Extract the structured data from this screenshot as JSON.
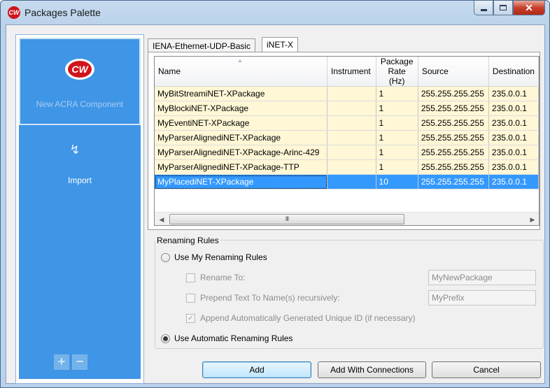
{
  "window": {
    "title": "Packages Palette",
    "app_icon": "CW"
  },
  "left_panel": {
    "new_component_label": "New ACRA Component",
    "logo_text": "CW",
    "import_label": "Import",
    "add_glyph": "+",
    "remove_glyph": "−"
  },
  "tabs": [
    {
      "label": "IENA-Ethernet-UDP-Basic",
      "active": false
    },
    {
      "label": "iNET-X",
      "active": true
    }
  ],
  "grid": {
    "columns": [
      "Name",
      "Instrument",
      "Package Rate (Hz)",
      "Source",
      "Destination"
    ],
    "rows": [
      {
        "name": "MyBitStreamiNET-XPackage",
        "instrument": "",
        "rate": "1",
        "source": "255.255.255.255",
        "destination": "235.0.0.1",
        "selected": false
      },
      {
        "name": "MyBlockiNET-XPackage",
        "instrument": "",
        "rate": "1",
        "source": "255.255.255.255",
        "destination": "235.0.0.1",
        "selected": false
      },
      {
        "name": "MyEventiNET-XPackage",
        "instrument": "",
        "rate": "1",
        "source": "255.255.255.255",
        "destination": "235.0.0.1",
        "selected": false
      },
      {
        "name": "MyParserAlignediNET-XPackage",
        "instrument": "",
        "rate": "1",
        "source": "255.255.255.255",
        "destination": "235.0.0.1",
        "selected": false
      },
      {
        "name": "MyParserAlignediNET-XPackage-Arinc-429",
        "instrument": "",
        "rate": "1",
        "source": "255.255.255.255",
        "destination": "235.0.0.1",
        "selected": false
      },
      {
        "name": "MyParserAlignediNET-XPackage-TTP",
        "instrument": "",
        "rate": "1",
        "source": "255.255.255.255",
        "destination": "235.0.0.1",
        "selected": false
      },
      {
        "name": "MyPlacediNET-XPackage",
        "instrument": "",
        "rate": "10",
        "source": "255.255.255.255",
        "destination": "235.0.0.1",
        "selected": true
      }
    ],
    "scroll_grip": "III"
  },
  "renaming": {
    "group_title": "Renaming Rules",
    "use_my_rules_label": "Use My Renaming Rules",
    "use_my_rules_checked": false,
    "rename_to_label": "Rename To:",
    "rename_to_checked": false,
    "rename_to_value": "MyNewPackage",
    "prepend_label": "Prepend Text To Name(s) recursively:",
    "prepend_checked": false,
    "prepend_value": "MyPrefix",
    "append_label": "Append Automatically Generated Unique ID (if necessary)",
    "append_checked": true,
    "use_auto_rules_label": "Use Automatic Renaming Rules",
    "use_auto_rules_checked": true
  },
  "buttons": {
    "add": "Add",
    "add_with_connections": "Add With Connections",
    "cancel": "Cancel"
  }
}
